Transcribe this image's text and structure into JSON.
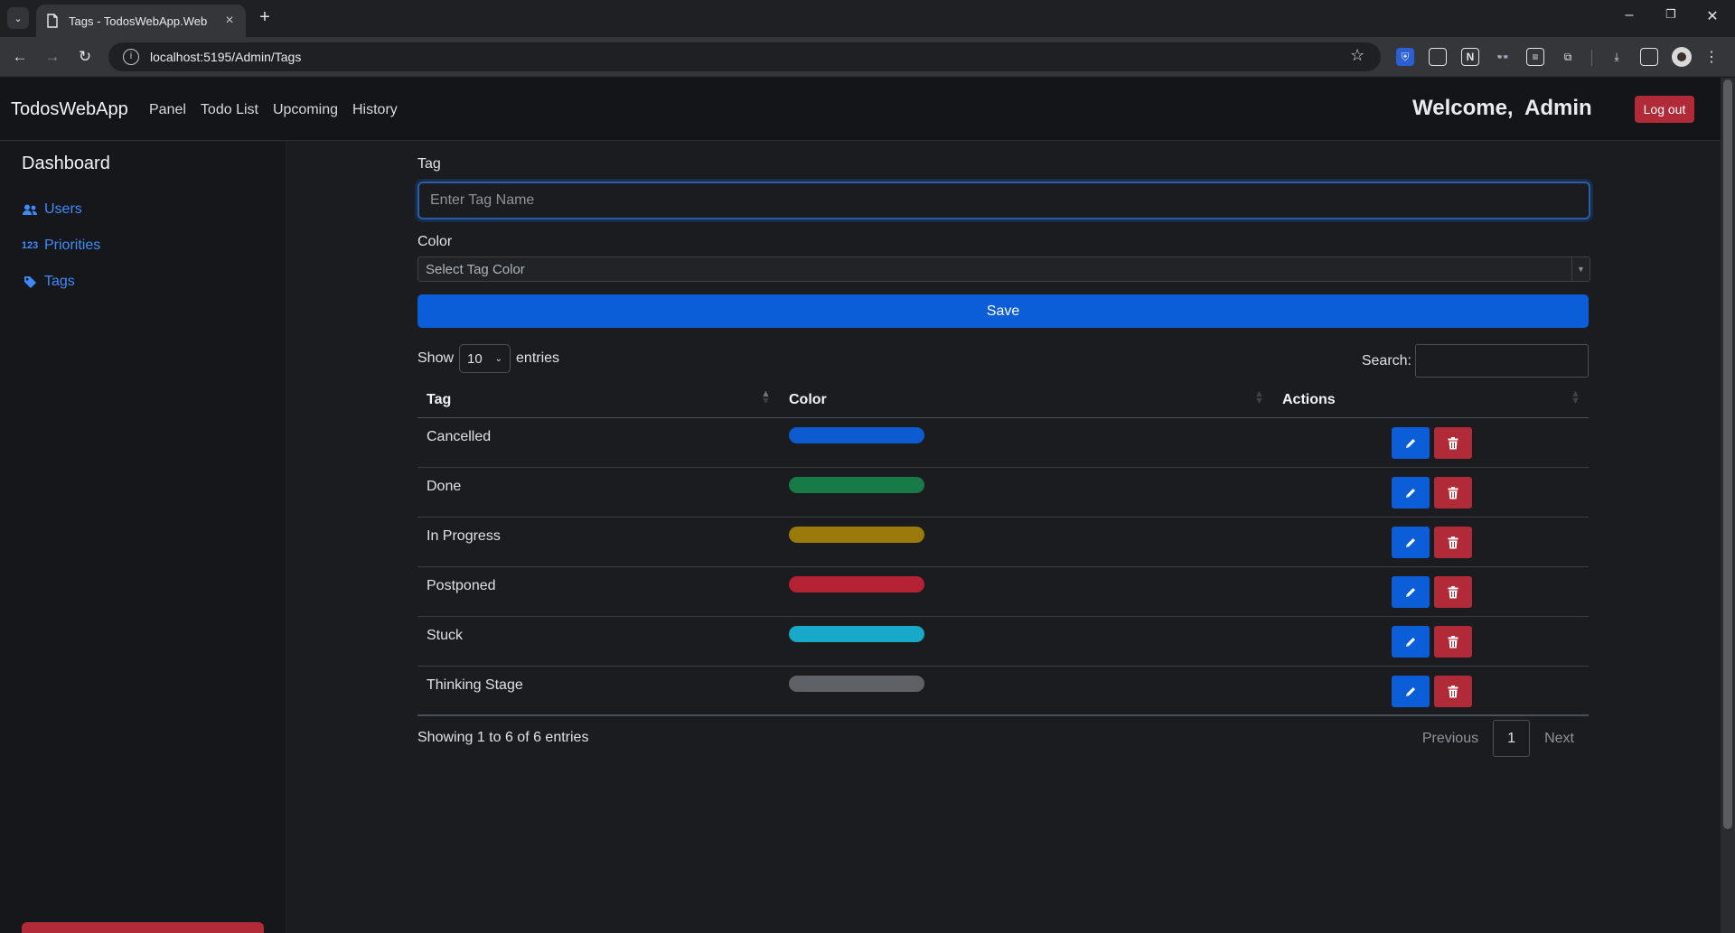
{
  "browser": {
    "tab_title": "Tags - TodosWebApp.Web",
    "url": "localhost:5195/Admin/Tags"
  },
  "navbar": {
    "brand": "TodosWebApp",
    "links": [
      "Panel",
      "Todo List",
      "Upcoming",
      "History"
    ],
    "welcome": "Welcome,  Admin",
    "logout_label": "Log out"
  },
  "sidebar": {
    "title": "Dashboard",
    "items": [
      {
        "label": "Users",
        "icon": "users-icon"
      },
      {
        "label": "Priorities",
        "icon": "numbers-123-icon",
        "icon_text": "123"
      },
      {
        "label": "Tags",
        "icon": "tag-icon"
      }
    ]
  },
  "form": {
    "tag_label": "Tag",
    "tag_placeholder": "Enter Tag Name",
    "color_label": "Color",
    "color_placeholder": "Select Tag Color",
    "save_label": "Save"
  },
  "table_controls": {
    "show_label": "Show",
    "page_length": "10",
    "entries_label": "entries",
    "search_label": "Search:"
  },
  "table": {
    "headers": [
      "Tag",
      "Color",
      "Actions"
    ],
    "rows": [
      {
        "tag": "Cancelled",
        "color": "#0d5bd0"
      },
      {
        "tag": "Done",
        "color": "#187a47"
      },
      {
        "tag": "In Progress",
        "color": "#9a7a0a"
      },
      {
        "tag": "Postponed",
        "color": "#b42233"
      },
      {
        "tag": "Stuck",
        "color": "#18a8c8"
      },
      {
        "tag": "Thinking Stage",
        "color": "#5e6166"
      }
    ]
  },
  "footer": {
    "info": "Showing 1 to 6 of 6 entries",
    "previous_label": "Previous",
    "page": "1",
    "next_label": "Next"
  }
}
